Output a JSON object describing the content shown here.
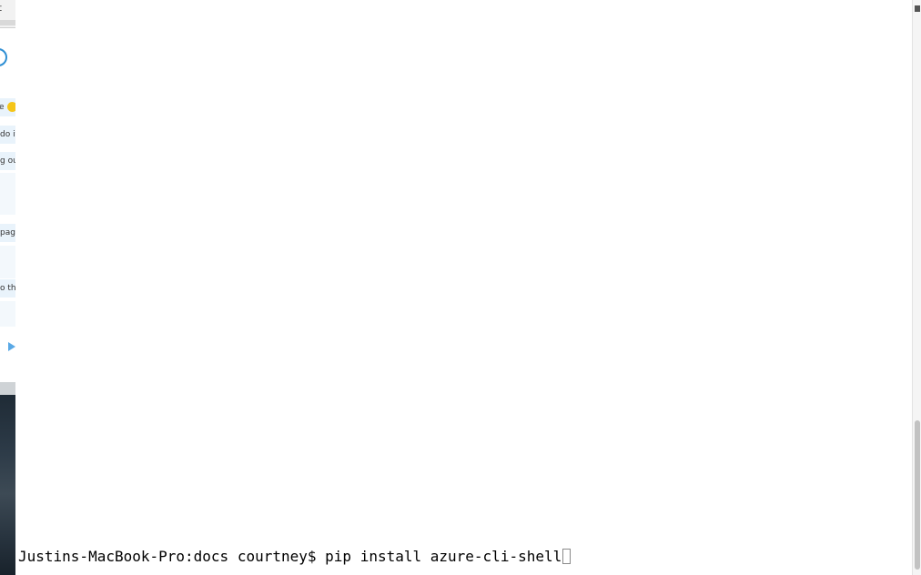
{
  "chat": {
    "topbar_fragment": "t",
    "messages": [
      {
        "fragment": "e"
      },
      {
        "fragment": "do it"
      },
      {
        "fragment": "g ou"
      },
      {
        "fragment": "pag"
      },
      {
        "fragment": "o the"
      }
    ]
  },
  "terminal": {
    "prompt": "Justins-MacBook-Pro:docs courtney$ ",
    "command": "pip install azure-cli-shell"
  }
}
